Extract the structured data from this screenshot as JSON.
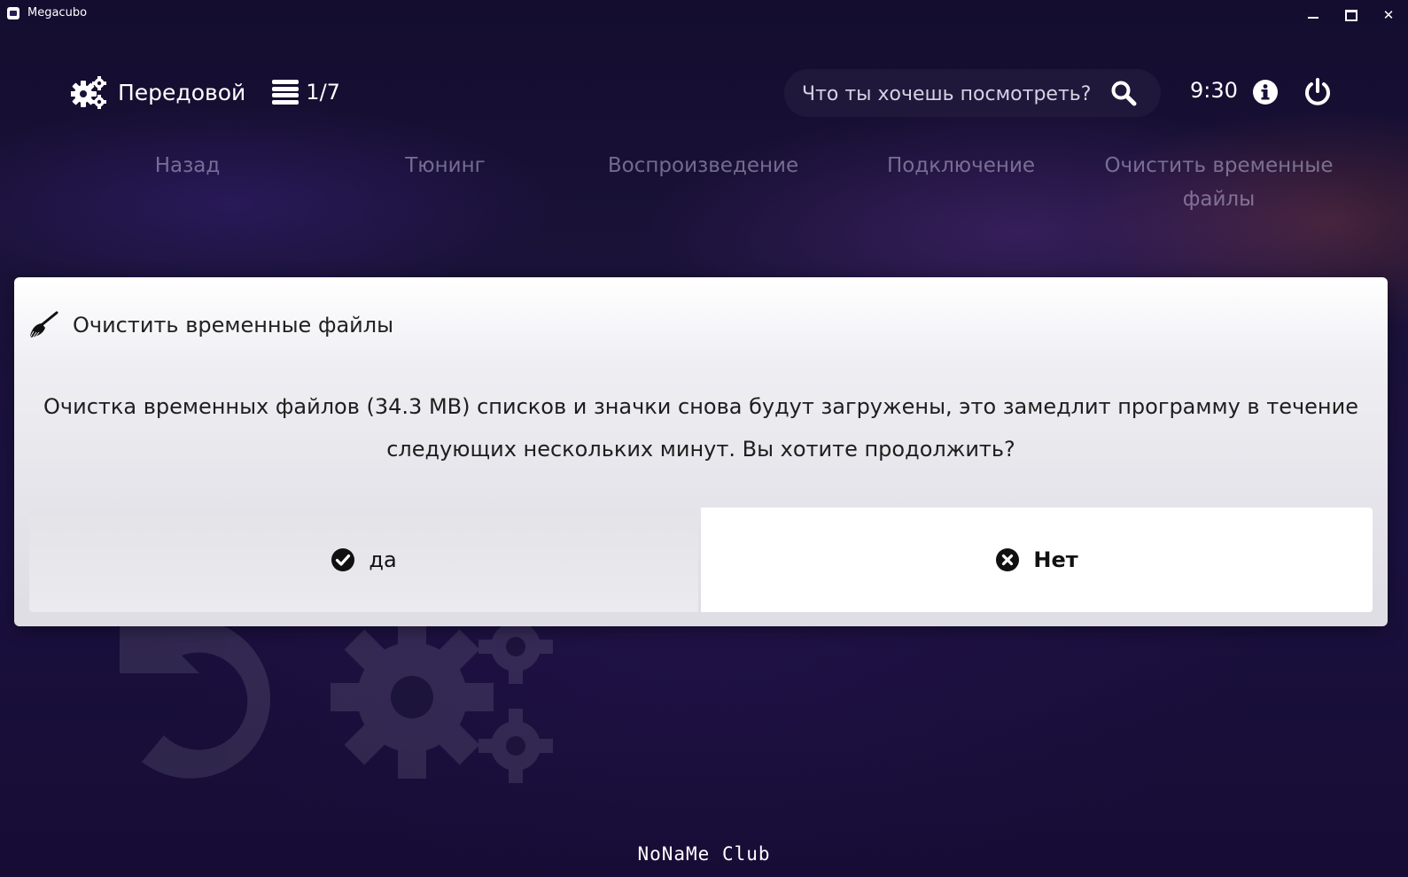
{
  "window": {
    "title": "Megacubo",
    "minimize_icon": "minimize-icon",
    "maximize_icon": "maximize-icon",
    "close_label": "✕"
  },
  "header": {
    "section_icon": "gears-icon",
    "section_title": "Передовой",
    "menu_icon": "list-icon",
    "page_counter": "1/7",
    "search": {
      "placeholder": "Что ты хочешь посмотреть?",
      "value": "",
      "icon": "search-icon"
    },
    "clock": "9:30",
    "info_icon": "info-icon",
    "power_icon": "power-icon"
  },
  "nav": {
    "tabs": [
      {
        "label": "Назад"
      },
      {
        "label": "Тюнинг"
      },
      {
        "label": "Воспроизведение"
      },
      {
        "label": "Подключение"
      },
      {
        "label": "Очистить временные файлы"
      }
    ]
  },
  "dialog": {
    "icon": "broom-icon",
    "title": "Очистить временные файлы",
    "message": "Очистка временных файлов (34.3 MB) списков и значки снова будут загружены, это замедлит программу в течение следующих нескольких минут. Вы хотите продолжить?",
    "yes_label": "да",
    "yes_icon": "check-circle-icon",
    "no_label": "Нет",
    "no_icon": "times-circle-icon"
  },
  "watermark": "NoNaMe Club",
  "colors": {
    "background": "#1a1238",
    "dialog_bg": "#ececf0",
    "nav_text": "#beb6d7",
    "selected_button": "#ffffff"
  }
}
